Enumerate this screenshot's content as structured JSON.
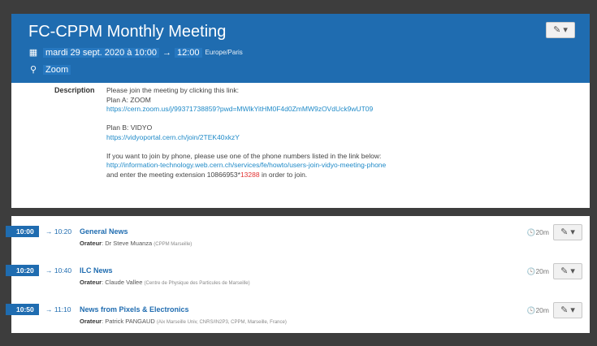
{
  "event": {
    "title": "FC-CPPM Monthly Meeting",
    "date_start": "mardi 29 sept. 2020 à 10:00",
    "arrow": "→",
    "time_end": "12:00",
    "timezone": "Europe/Paris",
    "location": "Zoom",
    "edit_icon": "✎ ▾"
  },
  "description": {
    "label": "Description",
    "line1": "Please join the meeting by clicking this link:",
    "line2": "Plan A: ZOOM",
    "link1": "https://cern.zoom.us/j/99371738859?pwd=MWlkYitHM0F4d0ZmMW9zOVdUck9wUT09",
    "line3": "Plan B: VIDYO",
    "link2": "https://vidyoportal.cern.ch/join/2TEK40xkzY",
    "line4": "If you want to join by phone, please use one of the phone numbers listed in the link below:",
    "link3": "http://information-technology.web.cern.ch/services/fe/howto/users-join-vidyo-meeting-phone",
    "line5_pre": "and enter the meeting extension 10866953*",
    "line5_code": "13288",
    "line5_post": " in order to join."
  },
  "timetable": [
    {
      "start": "10:00",
      "end": "→ 10:20",
      "title": "General News",
      "speaker_label": "Orateur",
      "speaker": ": Dr Steve Muanza",
      "affiliation": "(CPPM Marseille)",
      "duration": "🕓20m"
    },
    {
      "start": "10:20",
      "end": "→ 10:40",
      "title": "ILC News",
      "speaker_label": "Orateur",
      "speaker": ": Claude Vallee",
      "affiliation": "(Centre de Physique des Particules de Marseille)",
      "duration": "🕓20m"
    },
    {
      "start": "10:50",
      "end": "→ 11:10",
      "title": "News from Pixels & Electronics",
      "speaker_label": "Orateur",
      "speaker": ": Patrick PANGAUD",
      "affiliation": "(Aix Marseille Univ, CNRS/IN2P3, CPPM, Marseille, France)",
      "duration": "🕓20m"
    }
  ]
}
